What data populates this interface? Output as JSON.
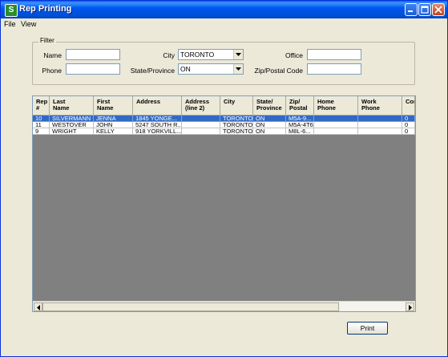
{
  "window": {
    "title": "Rep Printing"
  },
  "menu": {
    "file": "File",
    "view": "View"
  },
  "filter": {
    "legend": "Filter",
    "name_label": "Name",
    "name_value": "",
    "phone_label": "Phone",
    "phone_value": "",
    "city_label": "City",
    "city_value": "TORONTO",
    "state_label": "State/Province",
    "state_value": "ON",
    "office_label": "Office",
    "office_value": "",
    "zip_label": "Zip/Postal Code",
    "zip_value": ""
  },
  "grid": {
    "columns": [
      "Rep\n#",
      "Last\nName",
      "First\nName",
      "Address",
      "Address\n(line 2)",
      "City",
      "State/\nProvince",
      "Zip/\nPostal",
      "Home\nPhone",
      "Work\nPhone",
      "Con"
    ],
    "rows": [
      {
        "selected": true,
        "cells": [
          "10",
          "SILVERMANN",
          "JENNA",
          "1845 YONGE...",
          "",
          "TORONTO",
          "ON",
          "M5A-9...",
          "",
          "",
          "0"
        ]
      },
      {
        "selected": false,
        "cells": [
          "11",
          "WESTOVER",
          "JOHN",
          "5247 SOUTH R...",
          "",
          "TORONTO",
          "ON",
          "M5A-4T6",
          "",
          "",
          "0"
        ]
      },
      {
        "selected": false,
        "cells": [
          "9",
          "WRIGHT",
          "KELLY",
          "918 YORKVILL...",
          "",
          "TORONTO",
          "ON",
          "M8L-6...",
          "",
          "",
          "0"
        ]
      }
    ]
  },
  "buttons": {
    "print": "Print"
  },
  "colors": {
    "selection": "#316AC5",
    "grid_background": "#808080",
    "titlebar": "#0058EE"
  }
}
